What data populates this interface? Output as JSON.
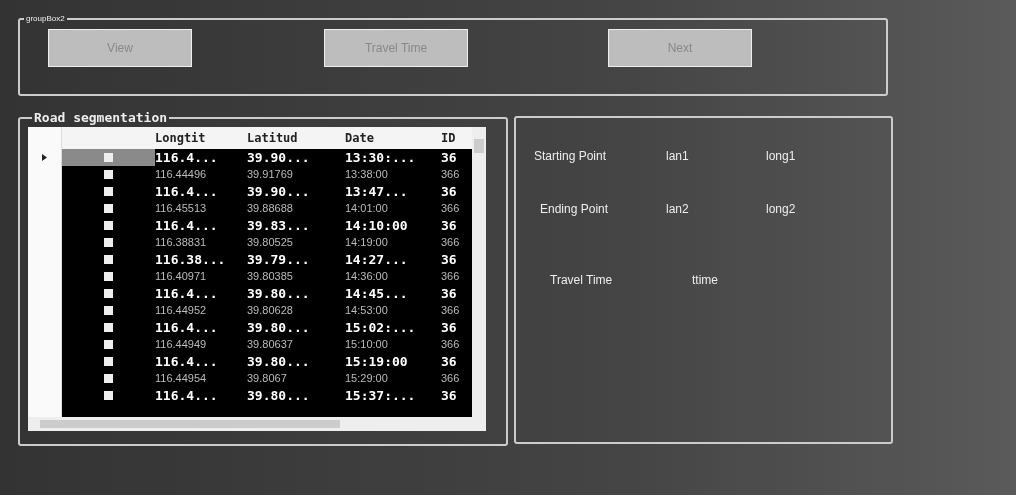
{
  "top_group": {
    "title": "groupBox2",
    "buttons": [
      "View",
      "Travel Time",
      "Next"
    ]
  },
  "road_segmentation": {
    "title": "Road segmentation",
    "columns": [
      "Longtit",
      "Latitud",
      "Date",
      "ID"
    ],
    "rows": [
      {
        "kind": "bold",
        "selected": true,
        "checked": false,
        "cells": [
          "116.4...",
          "39.90...",
          "13:30:...",
          "36"
        ]
      },
      {
        "kind": "plain",
        "selected": false,
        "checked": false,
        "cells": [
          "116.44496",
          "39.91769",
          "13:38:00",
          "366"
        ]
      },
      {
        "kind": "bold",
        "selected": false,
        "checked": false,
        "cells": [
          "116.4...",
          "39.90...",
          "13:47...",
          "36"
        ]
      },
      {
        "kind": "plain",
        "selected": false,
        "checked": false,
        "cells": [
          "116.45513",
          "39.88688",
          "14:01:00",
          "366"
        ]
      },
      {
        "kind": "bold",
        "selected": false,
        "checked": false,
        "cells": [
          "116.4...",
          "39.83...",
          "14:10:00",
          "36"
        ]
      },
      {
        "kind": "plain",
        "selected": false,
        "checked": false,
        "cells": [
          "116.38831",
          "39.80525",
          "14:19:00",
          "366"
        ]
      },
      {
        "kind": "bold",
        "selected": false,
        "checked": false,
        "cells": [
          "116.38...",
          "39.79...",
          "14:27...",
          "36"
        ]
      },
      {
        "kind": "plain",
        "selected": false,
        "checked": false,
        "cells": [
          "116.40971",
          "39.80385",
          "14:36:00",
          "366"
        ]
      },
      {
        "kind": "bold",
        "selected": false,
        "checked": false,
        "cells": [
          "116.4...",
          "39.80...",
          "14:45...",
          "36"
        ]
      },
      {
        "kind": "plain",
        "selected": false,
        "checked": false,
        "cells": [
          "116.44952",
          "39.80628",
          "14:53:00",
          "366"
        ]
      },
      {
        "kind": "bold",
        "selected": false,
        "checked": false,
        "cells": [
          "116.4...",
          "39.80...",
          "15:02:...",
          "36"
        ]
      },
      {
        "kind": "plain",
        "selected": false,
        "checked": false,
        "cells": [
          "116.44949",
          "39.80637",
          "15:10:00",
          "366"
        ]
      },
      {
        "kind": "bold",
        "selected": false,
        "checked": false,
        "cells": [
          "116.4...",
          "39.80...",
          "15:19:00",
          "36"
        ]
      },
      {
        "kind": "plain",
        "selected": false,
        "checked": false,
        "cells": [
          "116.44954",
          "39.8067",
          "15:29:00",
          "366"
        ]
      },
      {
        "kind": "bold",
        "selected": false,
        "checked": false,
        "cells": [
          "116.4...",
          "39.80...",
          "15:37:...",
          "36"
        ]
      }
    ]
  },
  "details": {
    "rows": [
      {
        "label": "Starting Point",
        "values": [
          "lan1",
          "long1"
        ]
      },
      {
        "label": "Ending Point",
        "values": [
          "lan2",
          "long2"
        ]
      },
      {
        "label": "Travel Time",
        "values": [
          "ttime"
        ]
      }
    ]
  }
}
